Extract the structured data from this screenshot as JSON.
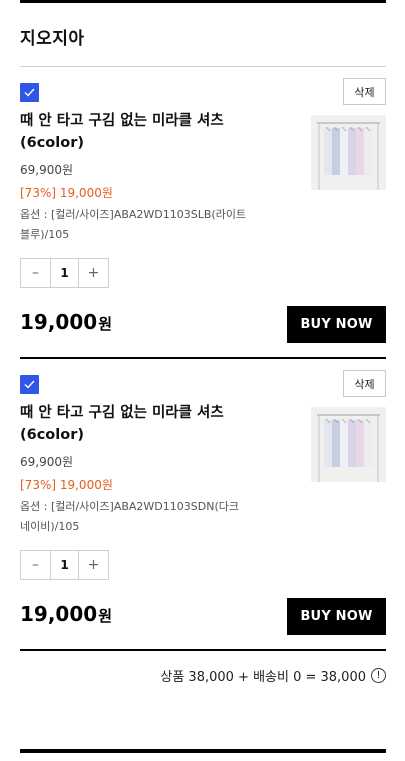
{
  "store": {
    "name": "지오지아"
  },
  "items": [
    {
      "delete_label": "삭제",
      "title": "때 안 타고 구김 없는 미라클 셔츠 (6color)",
      "original_price": "69,900원",
      "sale": "[73%] 19,000원",
      "option": "옵션 : [컬러/사이즈]ABA2WD1103SLB(라이트블루)/105",
      "quantity": "1",
      "minus": "–",
      "plus": "+",
      "total_number": "19,000",
      "total_unit": "원",
      "buy_label": "BUY NOW",
      "checked": true
    },
    {
      "delete_label": "삭제",
      "title": "때 안 타고 구김 없는 미라클 셔츠 (6color)",
      "original_price": "69,900원",
      "sale": "[73%] 19,000원",
      "option": "옵션 : [컬러/사이즈]ABA2WD1103SDN(다크네이비)/105",
      "quantity": "1",
      "minus": "–",
      "plus": "+",
      "total_number": "19,000",
      "total_unit": "원",
      "buy_label": "BUY NOW",
      "checked": true
    }
  ],
  "summary": {
    "text": "상품 38,000 + 배송비 0 = 38,000",
    "info_glyph": "!"
  },
  "colors": {
    "checkbox": "#2f56e7",
    "sale_text": "#e2611c",
    "buy_button": "#000000"
  },
  "icons": {
    "checkbox": "checkmark-icon",
    "thumbnail": "shirts-on-rack-image",
    "summary_info": "info-circle-icon"
  }
}
